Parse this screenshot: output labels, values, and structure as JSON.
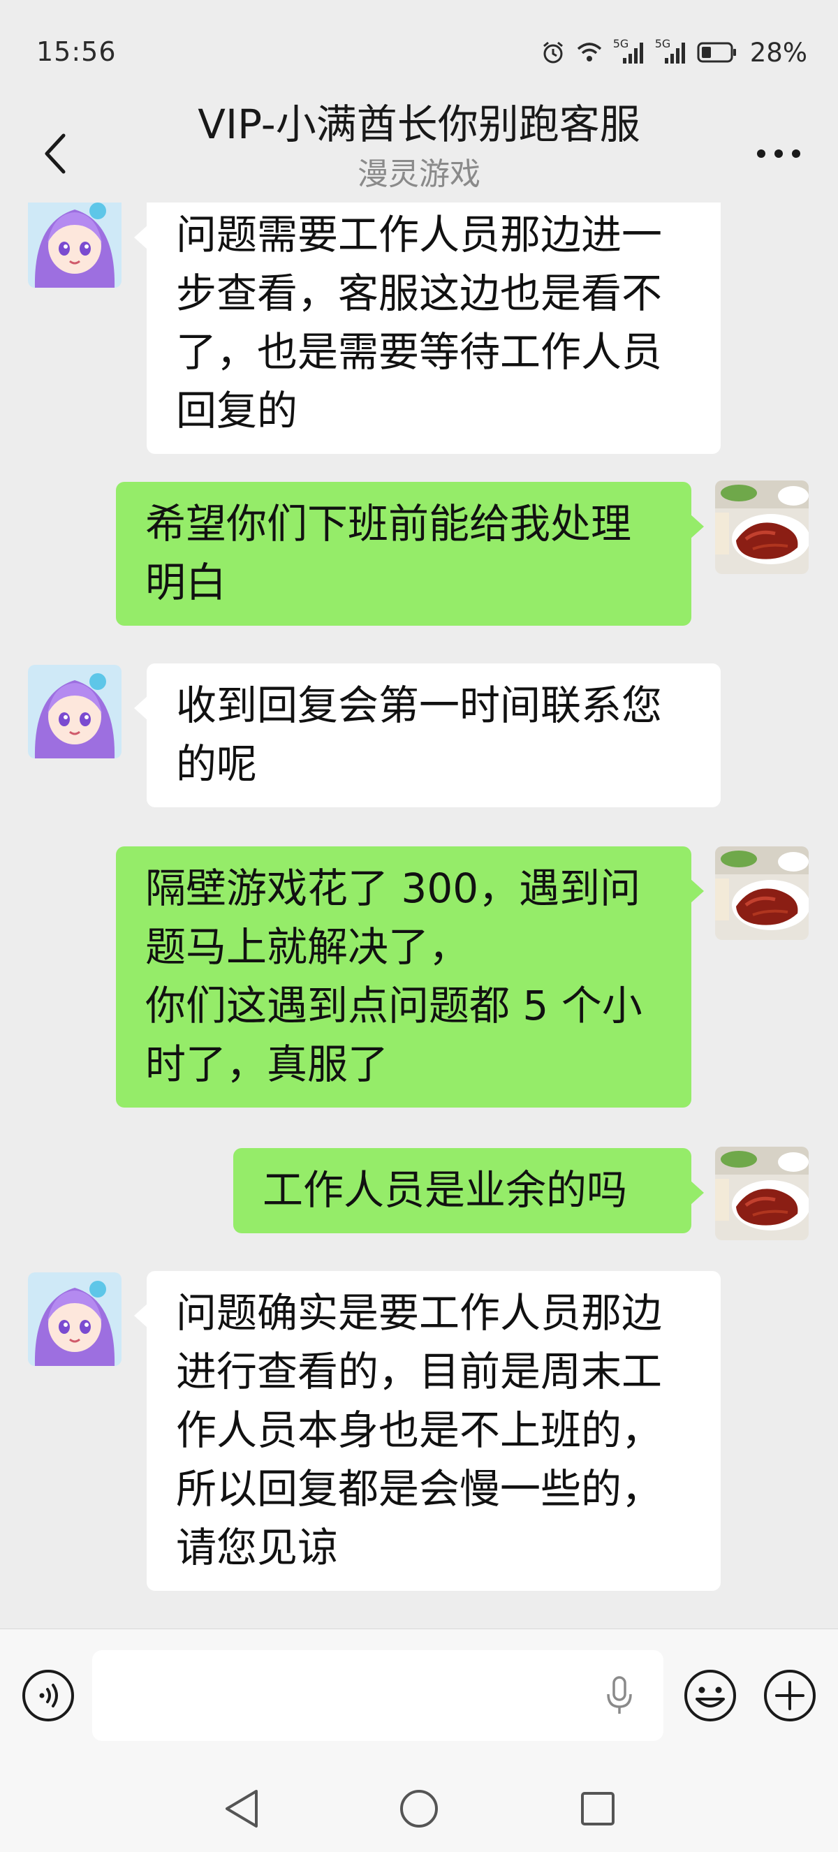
{
  "status_bar": {
    "time": "15:56",
    "network_1": "5G",
    "network_2": "5G",
    "battery_percent": "28%"
  },
  "header": {
    "title": "VIP-小满酋长你别跑客服",
    "subtitle": "漫灵游戏"
  },
  "messages": [
    {
      "from": "agent",
      "avatar": "anime-girl-avatar",
      "lines": [
        "问题需要工作人员那边进一",
        "步查看，客服这边也是看不",
        "了，也是需要等待工作人员",
        "回复的"
      ]
    },
    {
      "from": "me",
      "avatar": "food-avatar",
      "lines": [
        "希望你们下班前能给我处理",
        "明白"
      ]
    },
    {
      "from": "agent",
      "avatar": "anime-girl-avatar",
      "lines": [
        "收到回复会第一时间联系您",
        "的呢"
      ]
    },
    {
      "from": "me",
      "avatar": "food-avatar",
      "lines": [
        "隔壁游戏花了 300，遇到问",
        "题马上就解决了，",
        "你们这遇到点问题都 5 个小",
        "时了，真服了"
      ]
    },
    {
      "from": "me",
      "avatar": "food-avatar",
      "lines": [
        "工作人员是业余的吗"
      ]
    },
    {
      "from": "agent",
      "avatar": "anime-girl-avatar",
      "lines": [
        "问题确实是要工作人员那边",
        "进行查看的，目前是周末工",
        "作人员本身也是不上班的，",
        "所以回复都是会慢一些的，",
        "请您见谅"
      ]
    }
  ],
  "input_bar": {
    "value": "",
    "placeholder": ""
  },
  "icons": {
    "back": "chevron-left-icon",
    "more": "more-dots-icon",
    "voice": "voice-toggle-icon",
    "mic": "microphone-icon",
    "emoji": "emoji-icon",
    "plus": "plus-icon"
  },
  "colors": {
    "background": "#ededed",
    "bubble_out": "#95ec69",
    "bubble_in": "#ffffff",
    "text": "#111111",
    "subtitle": "#8a8a8a"
  }
}
